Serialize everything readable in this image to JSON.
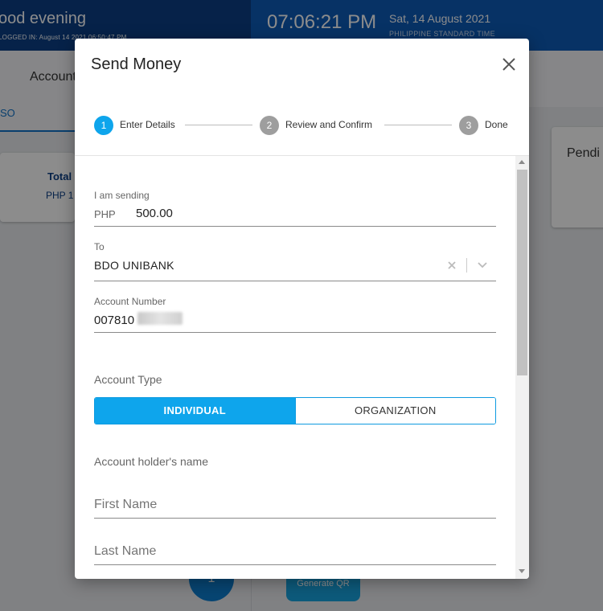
{
  "header": {
    "greeting": "ood evening",
    "last_login": "LOGGED IN: August 14 2021 06:50:47 PM",
    "clock": "07:06:21 PM",
    "date": "Sat, 14 August 2021",
    "timezone": "PHILIPPINE STANDARD TIME"
  },
  "background": {
    "tab_accounts": "Account",
    "tab_so": "SO",
    "total_label": "Total",
    "total_value": "PHP 1",
    "pending_label": "Pendi",
    "fab_label": "1",
    "generate_qr": "Generate QR"
  },
  "modal": {
    "title": "Send Money",
    "steps": [
      {
        "num": "1",
        "label": "Enter Details",
        "active": true
      },
      {
        "num": "2",
        "label": "Review and Confirm",
        "active": false
      },
      {
        "num": "3",
        "label": "Done",
        "active": false
      }
    ],
    "colors": {
      "step_active": "#0ea5ec",
      "step_inactive": "#9e9e9e",
      "accent": "#0ea5ec"
    },
    "form": {
      "amount_label": "I am sending",
      "currency": "PHP",
      "amount": "500.00",
      "to_label": "To",
      "bank": "BDO UNIBANK",
      "account_number_label": "Account Number",
      "account_number": "007810",
      "account_type_label": "Account Type",
      "account_types": [
        "INDIVIDUAL",
        "ORGANIZATION"
      ],
      "selected_account_type": "INDIVIDUAL",
      "holder_name_label": "Account holder's name",
      "first_name_placeholder": "First Name",
      "last_name_placeholder": "Last Name"
    },
    "icons": {
      "close": "close-icon",
      "clear": "clear-icon",
      "dropdown": "chevron-down-icon"
    }
  }
}
